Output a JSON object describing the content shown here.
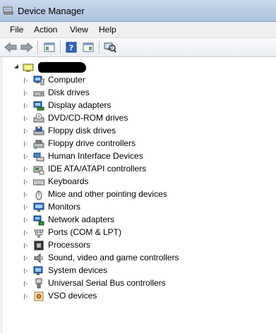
{
  "window": {
    "title": "Device Manager"
  },
  "menu": [
    "File",
    "Action",
    "View",
    "Help"
  ],
  "toolbar": {
    "buttons": [
      "back-arrow-icon",
      "forward-arrow-icon",
      "properties-pane-icon",
      "help-icon",
      "details-pane-icon",
      "scan-hardware-icon"
    ]
  },
  "tree": {
    "root_label": "",
    "items": [
      {
        "label": "Computer",
        "icon": "computer-icon"
      },
      {
        "label": "Disk drives",
        "icon": "disk-drive-icon"
      },
      {
        "label": "Display adapters",
        "icon": "display-adapter-icon"
      },
      {
        "label": "DVD/CD-ROM drives",
        "icon": "dvd-drive-icon"
      },
      {
        "label": "Floppy disk drives",
        "icon": "floppy-disk-icon"
      },
      {
        "label": "Floppy drive controllers",
        "icon": "floppy-controller-icon"
      },
      {
        "label": "Human Interface Devices",
        "icon": "hid-icon"
      },
      {
        "label": "IDE ATA/ATAPI controllers",
        "icon": "ide-controller-icon"
      },
      {
        "label": "Keyboards",
        "icon": "keyboard-icon"
      },
      {
        "label": "Mice and other pointing devices",
        "icon": "mouse-icon"
      },
      {
        "label": "Monitors",
        "icon": "monitor-icon"
      },
      {
        "label": "Network adapters",
        "icon": "network-adapter-icon"
      },
      {
        "label": "Ports (COM & LPT)",
        "icon": "port-icon"
      },
      {
        "label": "Processors",
        "icon": "processor-icon"
      },
      {
        "label": "Sound, video and game controllers",
        "icon": "speaker-icon"
      },
      {
        "label": "System devices",
        "icon": "system-device-icon"
      },
      {
        "label": "Universal Serial Bus controllers",
        "icon": "usb-icon"
      },
      {
        "label": "VSO devices",
        "icon": "vso-device-icon"
      }
    ]
  }
}
